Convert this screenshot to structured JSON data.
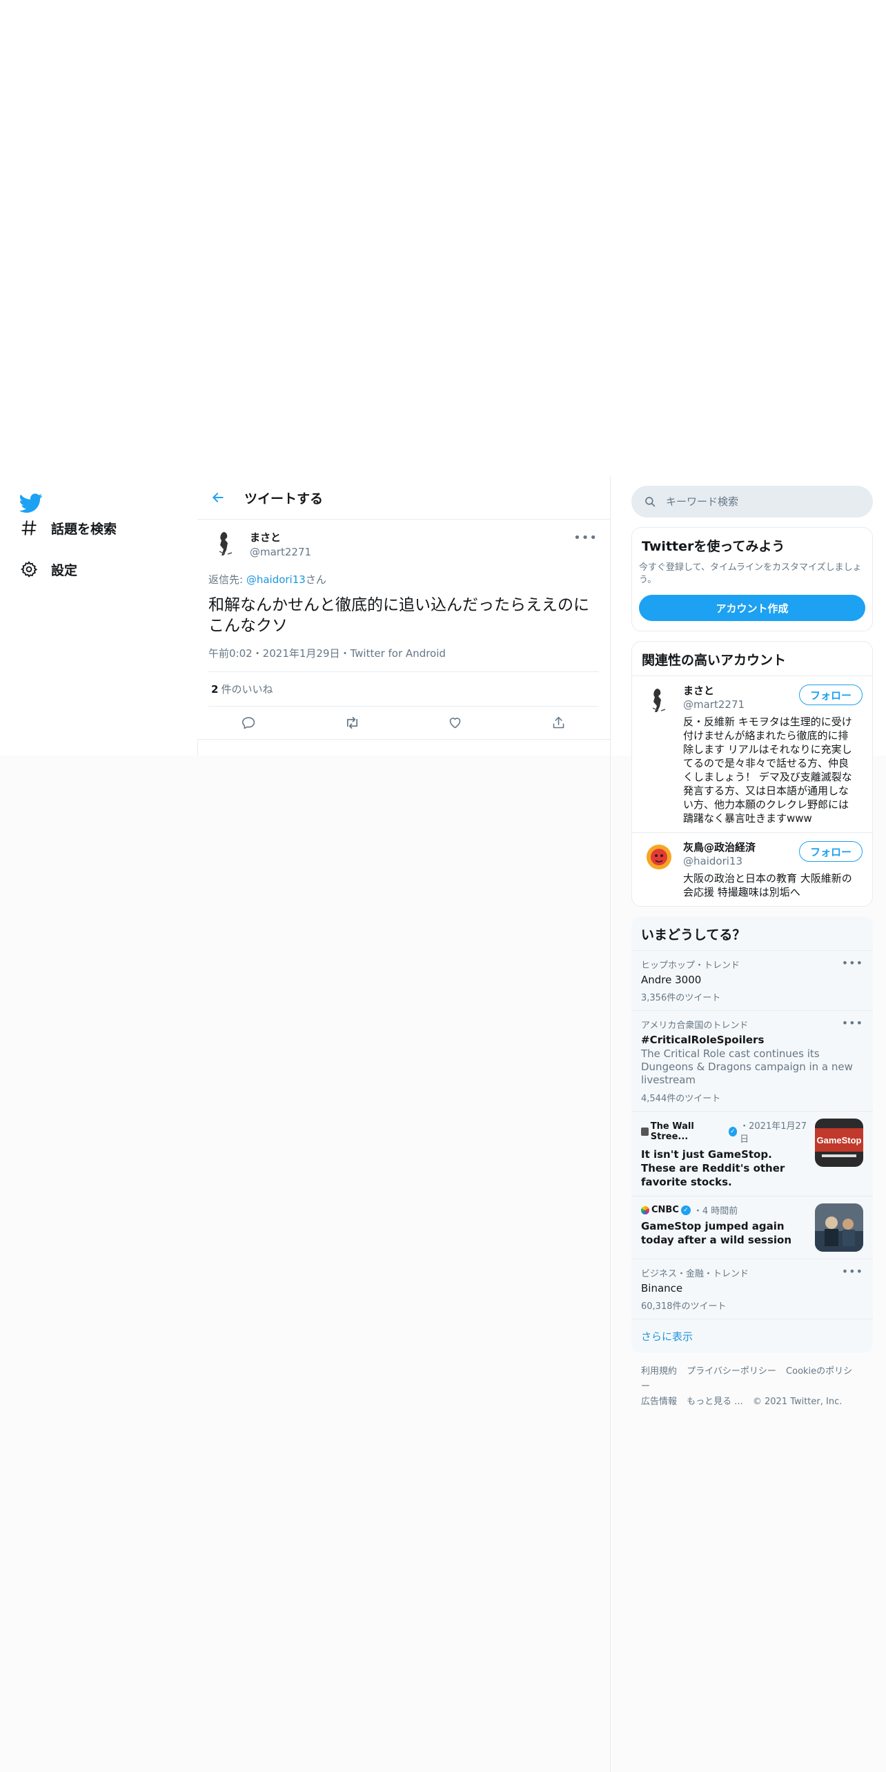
{
  "nav": {
    "logo_icon": "twitter-bird-icon",
    "items": [
      {
        "label": "話題を検索",
        "icon": "hashtag-icon"
      },
      {
        "label": "設定",
        "icon": "gear-icon"
      }
    ]
  },
  "main": {
    "header_title": "ツイートする",
    "tweet": {
      "author_name": "まさと",
      "author_handle": "@mart2271",
      "reply_prefix": "返信先: ",
      "reply_mention": "@haidori13",
      "reply_suffix": "さん",
      "text": "和解なんかせんと徹底的に追い込んだったらええのに\nこんなクソ",
      "meta": "午前0:02・2021年1月29日・Twitter for Android",
      "like_count": "2",
      "like_label": "件のいいね"
    }
  },
  "sidebar": {
    "search_placeholder": "キーワード検索",
    "signup": {
      "title": "Twitterを使ってみよう",
      "description": "今すぐ登録して、タイムラインをカスタマイズしましょう。",
      "button": "アカウント作成"
    },
    "related": {
      "title": "関連性の高いアカウント",
      "follow_label": "フォロー",
      "accounts": [
        {
          "name": "まさと",
          "handle": "@mart2271",
          "bio": "反・反維新 キモヲタは生理的に受け付けませんが絡まれたら徹底的に排除します リアルはそれなりに充実してるので是々非々で話せる方、仲良くしましょう！ デマ及び支離滅裂な発言する方、又は日本語が通用しない方、他力本願のクレクレ野郎には躊躇なく暴言吐きますwww"
        },
        {
          "name": "灰鳥@政治経済",
          "handle": "@haidori13",
          "bio": "大阪の政治と日本の教育 大阪維新の会応援 特撮趣味は別垢へ"
        }
      ]
    },
    "trends": {
      "title": "いまどうしてる？",
      "items": [
        {
          "context": "ヒップホップ・トレンド",
          "title": "Andre 3000",
          "count": "3,356件のツイート"
        },
        {
          "context": "アメリカ合衆国のトレンド",
          "title": "#CriticalRoleSpoilers",
          "description": "The Critical Role cast continues its Dungeons & Dragons campaign in a new livestream",
          "count": "4,544件のツイート"
        },
        {
          "context": "ビジネス・金融・トレンド",
          "title": "Binance",
          "count": "60,318件のツイート"
        }
      ],
      "news": [
        {
          "source": "The Wall Stree...",
          "time": "・2021年1月27日",
          "headline": "It isn't just GameStop. These are Reddit's other favorite stocks.",
          "thumb_text": "GameStop"
        },
        {
          "source": "CNBC",
          "time": "・4 時間前",
          "headline": "GameStop jumped again today after a wild session"
        }
      ],
      "show_more": "さらに表示"
    },
    "footer": {
      "links": [
        "利用規約",
        "プライバシーポリシー",
        "Cookieのポリシー",
        "広告情報",
        "もっと見る ..."
      ],
      "copyright": "© 2021 Twitter, Inc."
    }
  },
  "colors": {
    "accent": "#1da1f2",
    "link": "#1b95e0",
    "muted": "#657786",
    "border": "#e6ecf0"
  }
}
